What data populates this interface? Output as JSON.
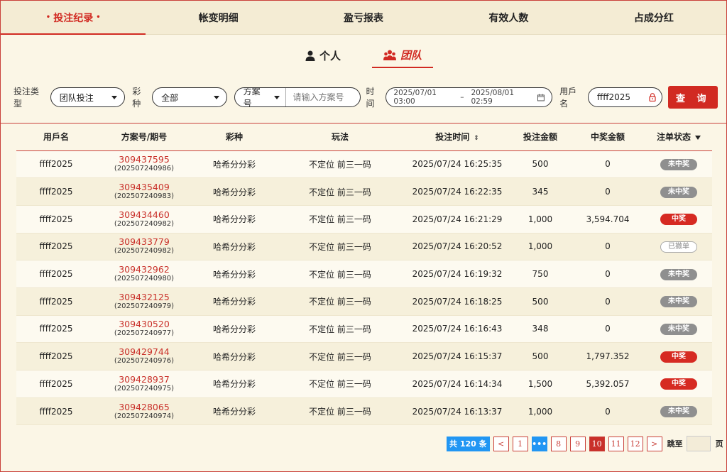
{
  "tabs": [
    {
      "label": "投注纪录",
      "active": true
    },
    {
      "label": "帐变明细",
      "active": false
    },
    {
      "label": "盈亏报表",
      "active": false
    },
    {
      "label": "有效人数",
      "active": false
    },
    {
      "label": "占成分红",
      "active": false
    }
  ],
  "active_tab_dot": "•",
  "subtoggle": {
    "personal": "个人",
    "team": "团队",
    "personal_icon": "person-icon",
    "team_icon": "team-icon"
  },
  "filters": {
    "bet_type_label": "投注类型",
    "bet_type_value": "团队投注",
    "lottery_label": "彩种",
    "lottery_value": "全部",
    "plan_select": "方案号",
    "plan_placeholder": "请输入方案号",
    "time_label": "时间",
    "date_start": "2025/07/01 03:00",
    "date_sep": "–",
    "date_end": "2025/08/01 02:59",
    "username_label": "用戶名",
    "username_value": "ffff2025",
    "query_button": "查 询"
  },
  "table": {
    "headers": [
      "用戶名",
      "方案号/期号",
      "彩种",
      "玩法",
      "投注时间",
      "投注金额",
      "中奖金额",
      "注单状态"
    ],
    "sort_icon": "⇕",
    "rows": [
      {
        "user": "ffff2025",
        "plan": "309437595",
        "period": "(202507240986)",
        "lottery": "哈希分分彩",
        "play": "不定位 前三一码",
        "time": "2025/07/24 16:25:35",
        "bet": "500",
        "win": "0",
        "status": "未中奖",
        "status_type": "grey"
      },
      {
        "user": "ffff2025",
        "plan": "309435409",
        "period": "(202507240983)",
        "lottery": "哈希分分彩",
        "play": "不定位 前三一码",
        "time": "2025/07/24 16:22:35",
        "bet": "345",
        "win": "0",
        "status": "未中奖",
        "status_type": "grey"
      },
      {
        "user": "ffff2025",
        "plan": "309434460",
        "period": "(202507240982)",
        "lottery": "哈希分分彩",
        "play": "不定位 前三一码",
        "time": "2025/07/24 16:21:29",
        "bet": "1,000",
        "win": "3,594.704",
        "status": "中奖",
        "status_type": "red"
      },
      {
        "user": "ffff2025",
        "plan": "309433779",
        "period": "(202507240982)",
        "lottery": "哈希分分彩",
        "play": "不定位 前三一码",
        "time": "2025/07/24 16:20:52",
        "bet": "1,000",
        "win": "0",
        "status": "已撤单",
        "status_type": "outline"
      },
      {
        "user": "ffff2025",
        "plan": "309432962",
        "period": "(202507240980)",
        "lottery": "哈希分分彩",
        "play": "不定位 前三一码",
        "time": "2025/07/24 16:19:32",
        "bet": "750",
        "win": "0",
        "status": "未中奖",
        "status_type": "grey"
      },
      {
        "user": "ffff2025",
        "plan": "309432125",
        "period": "(202507240979)",
        "lottery": "哈希分分彩",
        "play": "不定位 前三一码",
        "time": "2025/07/24 16:18:25",
        "bet": "500",
        "win": "0",
        "status": "未中奖",
        "status_type": "grey"
      },
      {
        "user": "ffff2025",
        "plan": "309430520",
        "period": "(202507240977)",
        "lottery": "哈希分分彩",
        "play": "不定位 前三一码",
        "time": "2025/07/24 16:16:43",
        "bet": "348",
        "win": "0",
        "status": "未中奖",
        "status_type": "grey"
      },
      {
        "user": "ffff2025",
        "plan": "309429744",
        "period": "(202507240976)",
        "lottery": "哈希分分彩",
        "play": "不定位 前三一码",
        "time": "2025/07/24 16:15:37",
        "bet": "500",
        "win": "1,797.352",
        "status": "中奖",
        "status_type": "red"
      },
      {
        "user": "ffff2025",
        "plan": "309428937",
        "period": "(202507240975)",
        "lottery": "哈希分分彩",
        "play": "不定位 前三一码",
        "time": "2025/07/24 16:14:34",
        "bet": "1,500",
        "win": "5,392.057",
        "status": "中奖",
        "status_type": "red"
      },
      {
        "user": "ffff2025",
        "plan": "309428065",
        "period": "(202507240974)",
        "lottery": "哈希分分彩",
        "play": "不定位 前三一码",
        "time": "2025/07/24 16:13:37",
        "bet": "1,000",
        "win": "0",
        "status": "未中奖",
        "status_type": "grey"
      }
    ]
  },
  "pagination": {
    "total": "共 120 条",
    "prev": "<",
    "next": ">",
    "pages": [
      "1",
      "•••",
      "8",
      "9",
      "10",
      "11",
      "12"
    ],
    "current": "10",
    "jump_label": "跳至",
    "page_suffix": "页"
  },
  "colors": {
    "accent": "#d12a22",
    "background": "#fbf6e6",
    "pager_blue": "#2196f3"
  }
}
